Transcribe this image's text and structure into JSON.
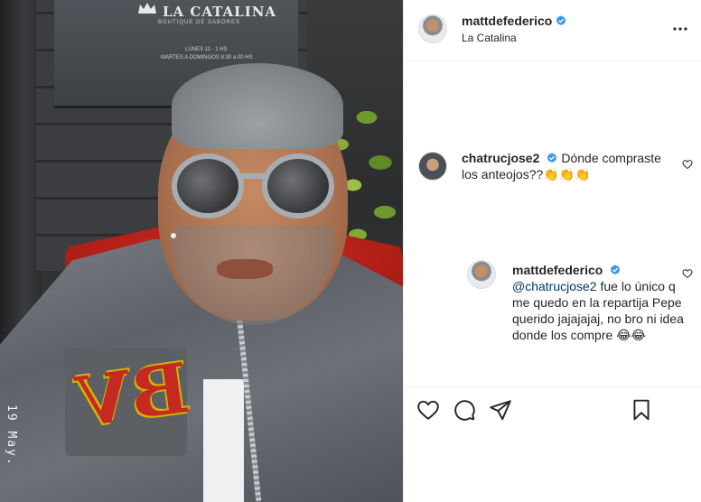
{
  "photo": {
    "shop_sign": "LA CATALINA",
    "shop_subtitle": "BOUTIQUE DE SABORES",
    "shop_hours_1": "LUNES 11 - 1 HS",
    "shop_hours_2": "MARTES A DOMINGOS 8:30 a 00 HS",
    "date_stamp": "19 May.",
    "patch_text": "BV"
  },
  "post": {
    "author": "mattdefederico",
    "location": "La Catalina",
    "more_icon": "more-horizontal-icon"
  },
  "comments": [
    {
      "username": "chatrucjose2",
      "verified": true,
      "text": "Dónde compraste los anteojos??",
      "emoji": "👏👏👏"
    },
    {
      "username": "mattdefederico",
      "verified": true,
      "mention": "@chatrucjose2",
      "text": "fue lo único q me quedo en la repartija Pepe querido jajajajaj, no bro ni idea donde los compre",
      "emoji": "😂😂"
    }
  ],
  "actions": {
    "like_icon": "heart-icon",
    "comment_icon": "comment-icon",
    "share_icon": "share-icon",
    "save_icon": "bookmark-icon"
  },
  "colors": {
    "verified_blue": "#3897f0",
    "text": "#262626",
    "mention": "#00376b",
    "divider": "#efefef"
  }
}
